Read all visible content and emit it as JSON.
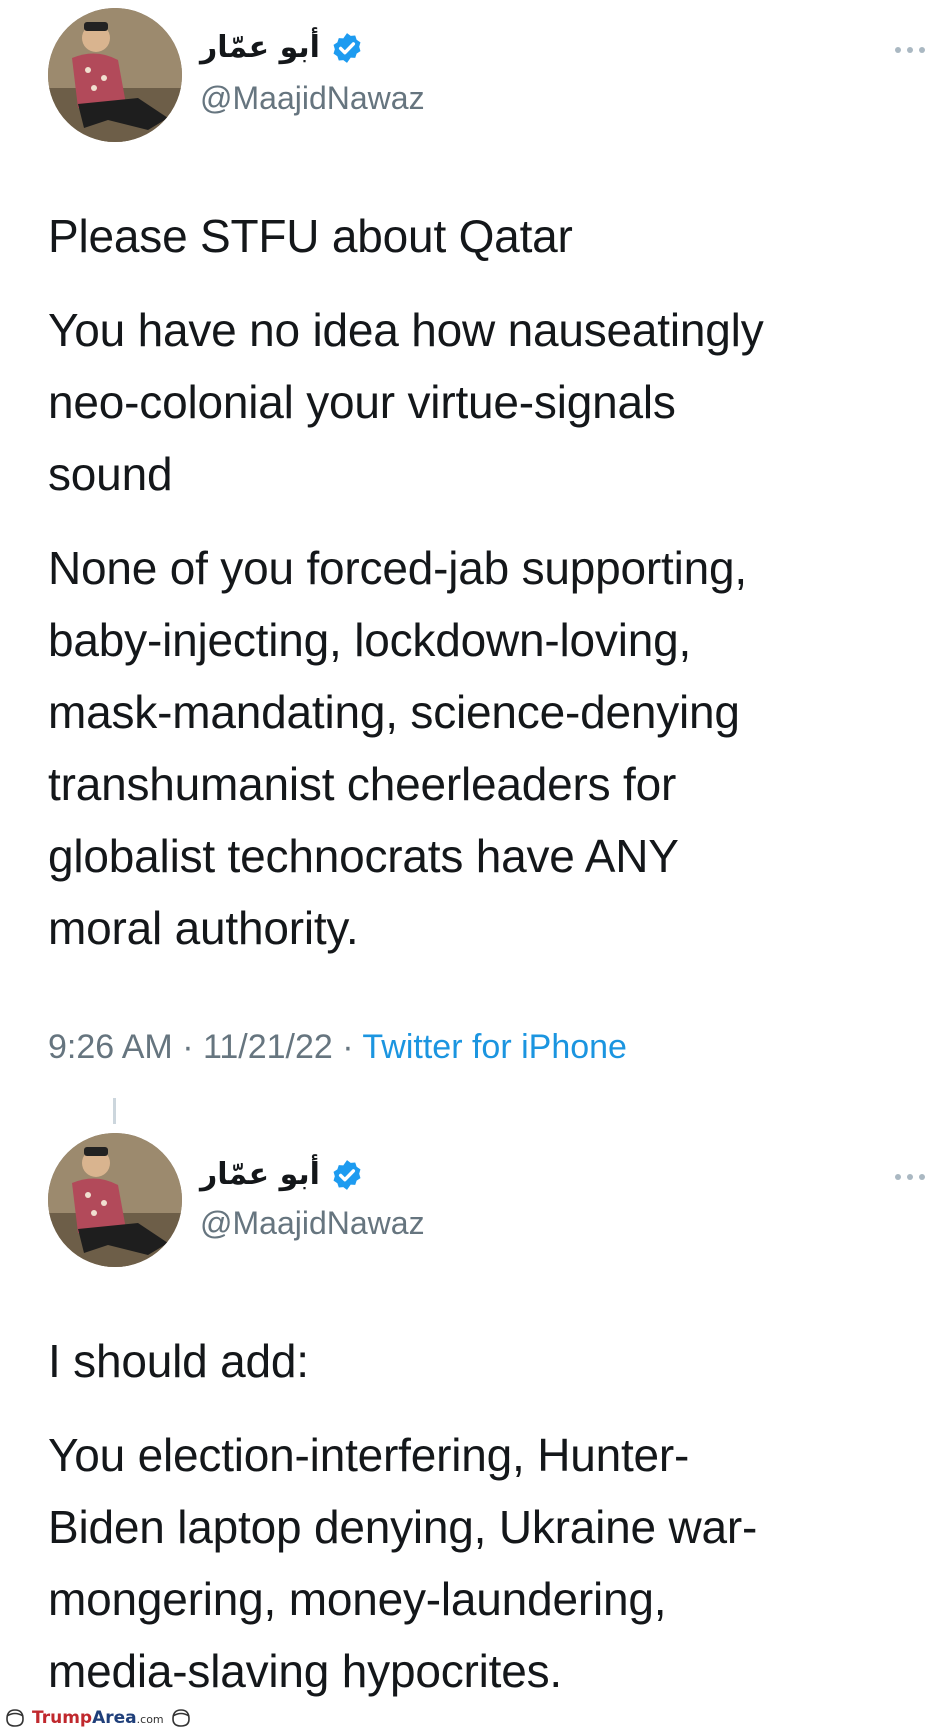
{
  "tweets": [
    {
      "display_name": "أبو عمّار",
      "handle": "@MaajidNawaz",
      "paragraphs": [
        "Please STFU about Qatar",
        "You have no idea how nauseatingly\nneo-colonial your virtue-signals\nsound",
        "None of you forced-jab supporting,\nbaby-injecting, lockdown-loving,\nmask-mandating, science-denying\ntranshumanist cheerleaders for\nglobalist technocrats have ANY\nmoral authority."
      ],
      "time": "9:26 AM",
      "date": "11/21/22",
      "separator": " · ",
      "source": "Twitter for iPhone"
    },
    {
      "display_name": "أبو عمّار",
      "handle": "@MaajidNawaz",
      "paragraphs": [
        "I should add:",
        "You election-interfering, Hunter-\nBiden laptop denying, Ukraine war-\nmongering, money-laundering,\nmedia-slaving hypocrites."
      ]
    }
  ],
  "icons": {
    "verified": "verified-badge-icon",
    "more": "more-options-icon"
  },
  "colors": {
    "text": "#14171a",
    "secondary": "#66757f",
    "link": "#1b95e0",
    "verified": "#1d9bf0"
  },
  "watermark": {
    "brand": "TrumpArea",
    "brand_part1": "Trump",
    "brand_part2": "Area",
    "tld": ".com"
  }
}
